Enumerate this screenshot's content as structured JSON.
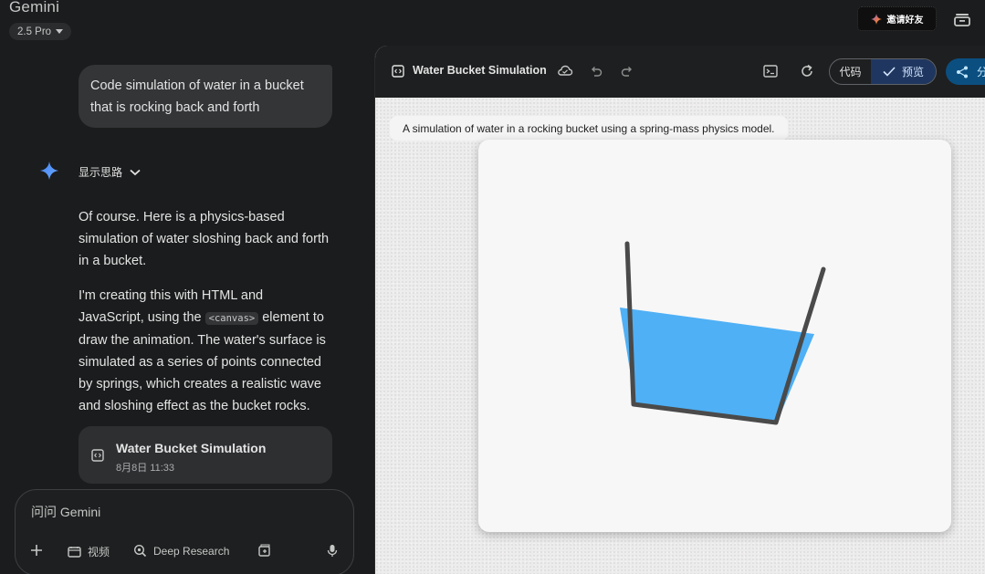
{
  "app": {
    "name": "Gemini",
    "model": "2.5 Pro",
    "invite_label": "邀请好友"
  },
  "chat": {
    "user_message": "Code simulation of water in a bucket that is rocking back and forth",
    "show_thinking_label": "显示思路",
    "response_p1": "Of course. Here is a physics-based simulation of water sloshing back and forth in a bucket.",
    "response_p2_before": "I'm creating this with HTML and JavaScript, using the ",
    "response_p2_code": "<canvas>",
    "response_p2_after": " element to draw the animation. The water's surface is simulated as a series of points connected by springs, which creates a realistic wave and sloshing effect as the bucket rocks.",
    "artifact_card": {
      "title": "Water Bucket Simulation",
      "date": "8月8日 11:33"
    }
  },
  "input": {
    "placeholder": "问问 Gemini",
    "tools": {
      "video_label": "视频",
      "deep_research_label": "Deep Research"
    }
  },
  "panel": {
    "title": "Water Bucket Simulation",
    "code_label": "代码",
    "preview_label": "预览",
    "share_label": "分",
    "description": "A simulation of water in a rocking bucket using a spring-mass physics model."
  },
  "colors": {
    "water": "#4fb0f5",
    "bucket_stroke": "#4a4a4a",
    "accent_blue": "#1f3760"
  },
  "icons": [
    "chevron-down-icon",
    "gemini-spark-icon",
    "code-artifact-icon",
    "cloud-sync-icon",
    "undo-icon",
    "redo-icon",
    "console-icon",
    "refresh-icon",
    "check-icon",
    "share-icon",
    "plus-icon",
    "video-icon",
    "deep-research-icon",
    "canvas-tool-icon",
    "mic-icon",
    "history-icon"
  ]
}
